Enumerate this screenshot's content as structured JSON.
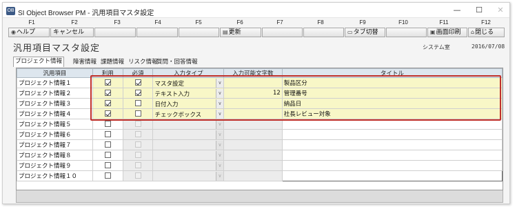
{
  "window": {
    "title": "SI Object Browser PM - 汎用項目マスタ設定",
    "icon_text": "OB",
    "minimize": "—",
    "maximize": "☐",
    "close": "✕"
  },
  "fkeys": [
    "F1",
    "F2",
    "F3",
    "F4",
    "F5",
    "F6",
    "F7",
    "F8",
    "F9",
    "F10",
    "F11",
    "F12"
  ],
  "toolbar": {
    "help": "ヘルプ",
    "cancel": "キャンセル",
    "update": "更新",
    "tab_switch": "タブ切替",
    "print": "画面印刷",
    "close": "閉じる"
  },
  "header": {
    "page_title": "汎用項目マスタ設定",
    "system_label": "システム室",
    "date": "2016/07/08"
  },
  "tabs": [
    "プロジェクト情報",
    "障害情報",
    "課題情報",
    "リスク情報",
    "質問・回答情報"
  ],
  "grid": {
    "columns": [
      "汎用項目",
      "利用",
      "必須",
      "入力タイプ",
      "入力可能文字数",
      "タイトル"
    ],
    "rows": [
      {
        "name": "プロジェクト情報１",
        "use": true,
        "required": true,
        "type": "マスタ設定",
        "length": "",
        "title": "製品区分"
      },
      {
        "name": "プロジェクト情報２",
        "use": true,
        "required": true,
        "type": "テキスト入力",
        "length": "12",
        "title": "管理番号"
      },
      {
        "name": "プロジェクト情報３",
        "use": true,
        "required": false,
        "type": "日付入力",
        "length": "",
        "title": "納品日"
      },
      {
        "name": "プロジェクト情報４",
        "use": true,
        "required": false,
        "type": "チェックボックス",
        "length": "",
        "title": "社長レビュー対象"
      },
      {
        "name": "プロジェクト情報５",
        "use": false,
        "required": false,
        "type": "",
        "length": "",
        "title": ""
      },
      {
        "name": "プロジェクト情報６",
        "use": false,
        "required": false,
        "type": "",
        "length": "",
        "title": ""
      },
      {
        "name": "プロジェクト情報７",
        "use": false,
        "required": false,
        "type": "",
        "length": "",
        "title": ""
      },
      {
        "name": "プロジェクト情報８",
        "use": false,
        "required": false,
        "type": "",
        "length": "",
        "title": ""
      },
      {
        "name": "プロジェクト情報９",
        "use": false,
        "required": false,
        "type": "",
        "length": "",
        "title": ""
      },
      {
        "name": "プロジェクト情報１０",
        "use": false,
        "required": false,
        "type": "",
        "length": "",
        "title": ""
      }
    ]
  },
  "colors": {
    "header_bg": "#dde6ee",
    "active_row_bg": "#f8f7c7",
    "highlight_border": "#c0302a"
  }
}
